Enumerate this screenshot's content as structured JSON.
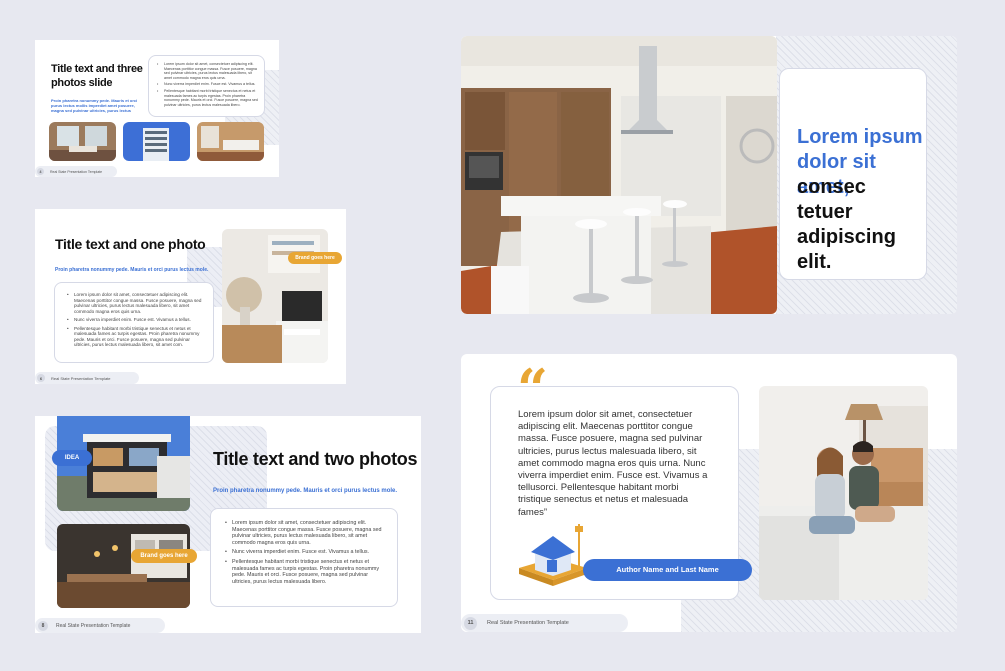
{
  "slide1": {
    "title": "Title text and three photos slide",
    "subtitle": "Proin pharetra nonummy pede. Mauris et orci purus lectus mollis imperdiet amet posuere, magna sed pulvinar ultricies, purus lectus",
    "bullets": [
      "Lorem ipsum dolor sit amet, consectetuer adipiscing elit. Maecenas porttitor congue massa. Fusce posuere, magna sed pulvinar ultricies, purus lectus malesuada libero, sit amet commodo magna eros quis urna.",
      "Nunc viverra imperdiet enim. Fusce est. Vivamus a tellus.",
      "Pellentesque habitant morbi tristique senectus et netus et malesuada fames ac turpis egestas. Proin pharetra nonummy pede. Mauris et orci. Fusce posuere, magna sed pulvinar ultricies, purus lectus malesuada libero."
    ],
    "footer": "Real State Presentation Template",
    "page": "4"
  },
  "slide2": {
    "title": "Title text and one photo",
    "subtitle": "Proin pharetra nonummy pede. Mauris et orci purus lectus mole.",
    "bullets": [
      "Lorem ipsum dolor sit amet, consectetuer adipiscing elit. Maecenas porttitor congue massa. Fusce posuere, magna sed pulvinar ultricies, purus lectus malesuada libero, sit amet commodo magna eros quis urna.",
      "Nunc viverra imperdiet enim. Fusce est. Vivamus a tellus.",
      "Pellentesque habitant morbi tristique senectus et netus et malesuada fames ac turpis egestas. Proin pharetra nonummy pede. Mauris et orci. Fusce posuere, magna sed pulvinar ultricies, purus lectus malesuada libero, sit amet com."
    ],
    "tag": "Brand goes here",
    "footer": "Real State Presentation Template",
    "page": "6"
  },
  "slide3": {
    "title": "Title text and two photos",
    "subtitle": "Proin pharetra nonummy pede. Mauris et orci purus lectus mole.",
    "bullets": [
      "Lorem ipsum dolor sit amet, consectetuer adipiscing elit. Maecenas porttitor congue massa. Fusce posuere, magna sed pulvinar ultricies, purus lectus malesuada libero, sit amet commodo magna eros quis urna.",
      "Nunc viverra imperdiet enim. Fusce est. Vivamus a tellus.",
      "Pellentesque habitant morbi tristique senectus et netus et malesuada fames ac turpis egestas. Proin pharetra nonummy pede. Mauris et orci. Fusce posuere, magna sed pulvinar ultricies, purus lectus malesuada libero."
    ],
    "badge": "IDEA",
    "tag": "Brand goes here",
    "footer": "Real State Presentation Template",
    "page": "8"
  },
  "slide4": {
    "heading_blue": "Lorem ipsum dolor sit amet,",
    "heading_dark": "consec tetuer adipiscing elit."
  },
  "slide5": {
    "quote_mark": "“",
    "quote": "Lorem ipsum dolor sit amet, consectetuer adipiscing elit. Maecenas porttitor congue massa. Fusce posuere, magna sed pulvinar ultricies, purus lectus malesuada libero, sit amet commodo magna eros quis urna. Nunc viverra imperdiet enim. Fusce est. Vivamus a tellusorci. Pellentesque habitant morbi tristique senectus et netus et malesuada fames”",
    "author": "Author Name and Last Name",
    "footer": "Real State Presentation Template",
    "page": "11"
  },
  "colors": {
    "accent_blue": "#3b70d4",
    "brand_orange": "#e8a634",
    "background": "#e7e8f0"
  }
}
